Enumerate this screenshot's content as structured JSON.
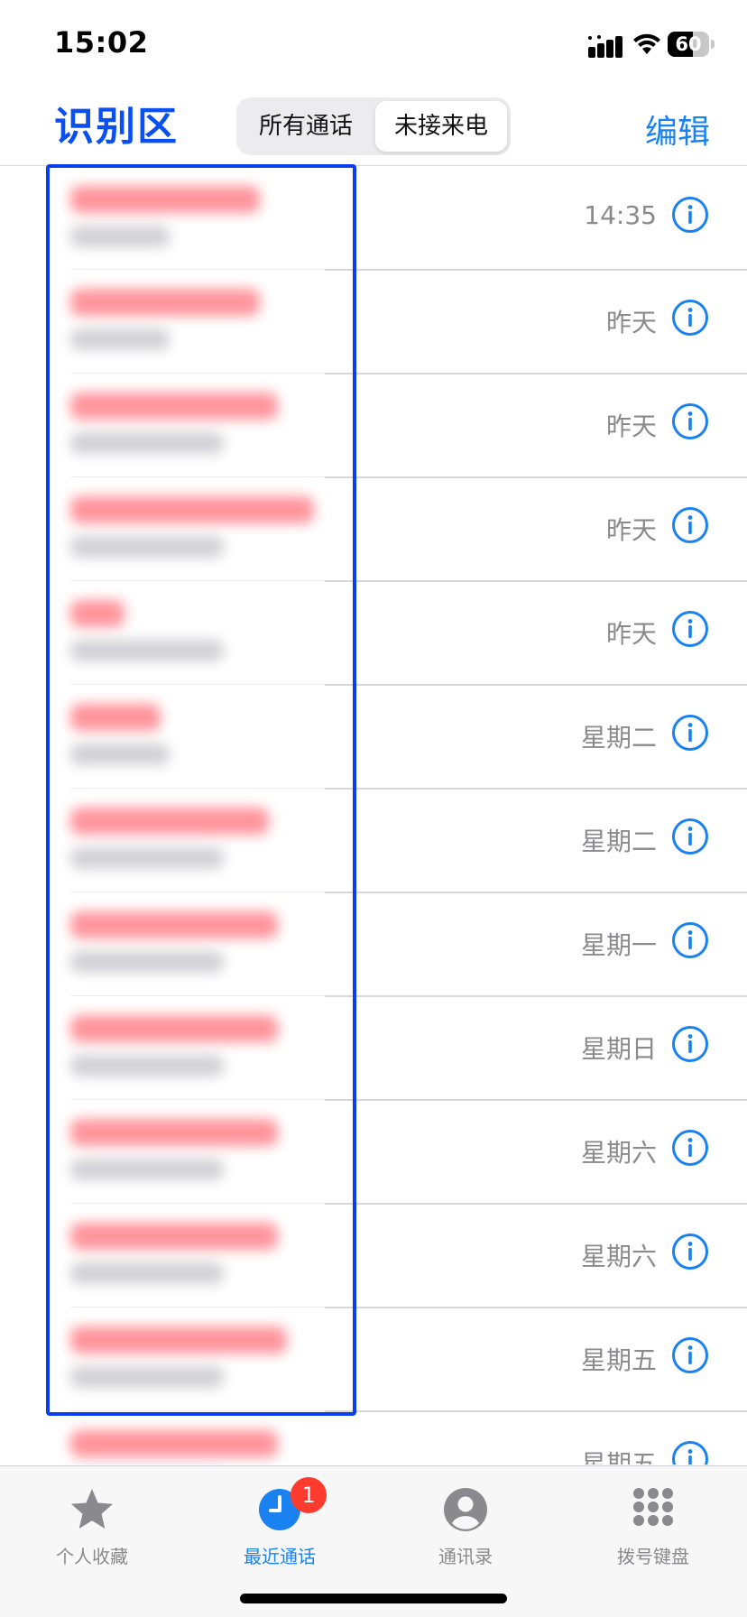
{
  "status_bar": {
    "time": "15:02",
    "battery_level": "60",
    "battery_fraction": 0.6
  },
  "header": {
    "left_label": "识别区",
    "segments": {
      "all": "所有通话",
      "missed": "未接来电"
    },
    "selected_segment": "missed",
    "edit_label": "编辑"
  },
  "calls": [
    {
      "time": "14:35"
    },
    {
      "time": "昨天"
    },
    {
      "time": "昨天"
    },
    {
      "time": "昨天"
    },
    {
      "time": "昨天"
    },
    {
      "time": "星期二"
    },
    {
      "time": "星期二"
    },
    {
      "time": "星期一"
    },
    {
      "time": "星期日"
    },
    {
      "time": "星期六"
    },
    {
      "time": "星期六"
    },
    {
      "time": "星期五"
    },
    {
      "time": "星期五"
    }
  ],
  "tab_bar": {
    "tabs": [
      {
        "label": "个人收藏",
        "icon": "star-icon"
      },
      {
        "label": "最近通话",
        "icon": "clock-icon",
        "badge": "1",
        "active": true
      },
      {
        "label": "通讯录",
        "icon": "person-icon"
      },
      {
        "label": "拨号键盘",
        "icon": "keypad-icon"
      }
    ]
  },
  "colors": {
    "accent": "#1a82f0",
    "highlight": "#0a3cf0",
    "badge": "#ff3b30"
  }
}
